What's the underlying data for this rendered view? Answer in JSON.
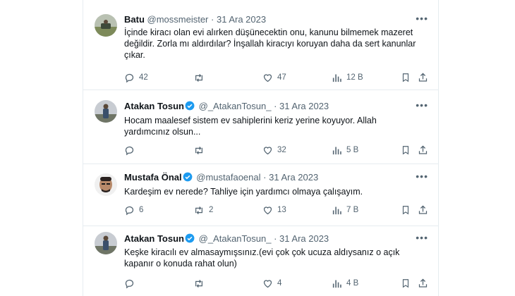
{
  "tweets": [
    {
      "name": "Batu",
      "handle": "@mossmeister",
      "separator": "·",
      "date": "31 Ara 2023",
      "verified": false,
      "body": "İçinde kiracı olan evi alırken düşünecektin onu, kanunu bilmemek mazeret değildir. Zorla mı aldırdılar? İnşallah kiracıyı koruyan daha da sert kanunlar çıkar.",
      "replies": "42",
      "retweets": "",
      "likes": "47",
      "views": "12 B"
    },
    {
      "name": "Atakan Tosun",
      "handle": "@_AtakanTosun_",
      "separator": "·",
      "date": "31 Ara 2023",
      "verified": true,
      "body": "Hocam maalesef sistem ev sahiplerini keriz yerine koyuyor. Allah yardımcınız olsun...",
      "replies": "",
      "retweets": "",
      "likes": "32",
      "views": "5 B"
    },
    {
      "name": "Mustafa Önal",
      "handle": "@mustafaoenal",
      "separator": "·",
      "date": "31 Ara 2023",
      "verified": true,
      "body": "Kardeşim ev nerede? Tahliye için yardımcı olmaya çalışayım.",
      "replies": "6",
      "retweets": "2",
      "likes": "13",
      "views": "7 B"
    },
    {
      "name": "Atakan Tosun",
      "handle": "@_AtakanTosun_",
      "separator": "·",
      "date": "31 Ara 2023",
      "verified": true,
      "body": "Keşke kiracılı ev almasaymışsınız.(evi çok çok ucuza aldıysanız o açık kapanır o konuda rahat olun)",
      "replies": "",
      "retweets": "",
      "likes": "4",
      "views": "4 B"
    }
  ],
  "icons": {
    "more": "ellipsis-icon",
    "reply": "reply-icon",
    "retweet": "retweet-icon",
    "like": "heart-icon",
    "views": "views-icon",
    "bookmark": "bookmark-icon",
    "share": "share-icon",
    "verified": "verified-badge-icon"
  },
  "colors": {
    "verified": "#1d9bf0",
    "secondary_text": "#536471",
    "divider": "#e6ecf0"
  },
  "more_glyph": "•••"
}
